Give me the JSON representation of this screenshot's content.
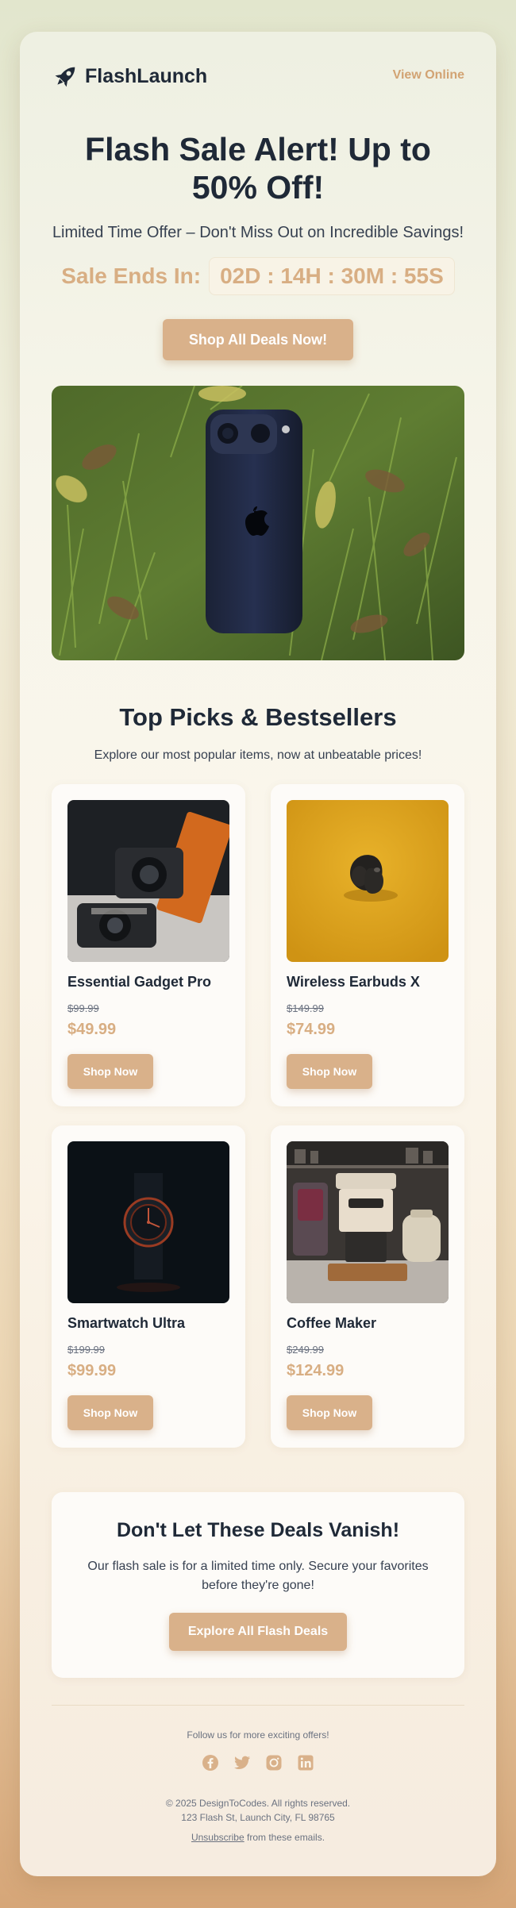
{
  "header": {
    "brand": "FlashLaunch",
    "view_online": "View Online",
    "logo_icon": "rocket-icon"
  },
  "hero": {
    "title": "Flash Sale Alert! Up to 50% Off!",
    "subtitle": "Limited Time Offer – Don't Miss Out on Incredible Savings!",
    "countdown_label": "Sale Ends In:",
    "countdown_value": "02D : 14H : 30M : 55S",
    "button": "Shop All Deals Now!"
  },
  "featured": {
    "title": "Top Picks & Bestsellers",
    "subtitle": "Explore our most popular items, now at unbeatable prices!"
  },
  "products": [
    {
      "name": "Essential Gadget Pro",
      "old_price": "$99.99",
      "price": "$49.99",
      "button": "Shop Now"
    },
    {
      "name": "Wireless Earbuds X",
      "old_price": "$149.99",
      "price": "$74.99",
      "button": "Shop Now"
    },
    {
      "name": "Smartwatch Ultra",
      "old_price": "$199.99",
      "price": "$99.99",
      "button": "Shop Now"
    },
    {
      "name": "Coffee Maker",
      "old_price": "$249.99",
      "price": "$124.99",
      "button": "Shop Now"
    }
  ],
  "cta": {
    "title": "Don't Let These Deals Vanish!",
    "text": "Our flash sale is for a limited time only. Secure your favorites before they're gone!",
    "button": "Explore All Flash Deals"
  },
  "footer": {
    "follow": "Follow us for more exciting offers!",
    "social_icons": [
      "facebook-icon",
      "twitter-icon",
      "instagram-icon",
      "linkedin-icon"
    ],
    "copyright": "© 2025 DesignToCodes. All rights reserved.",
    "address": "123 Flash St, Launch City, FL 98765",
    "unsubscribe_link": "Unsubscribe",
    "unsubscribe_rest": " from these emails."
  },
  "colors": {
    "accent": "#d9b18a",
    "accent_text": "#d8ae83",
    "heading": "#1f2937"
  }
}
